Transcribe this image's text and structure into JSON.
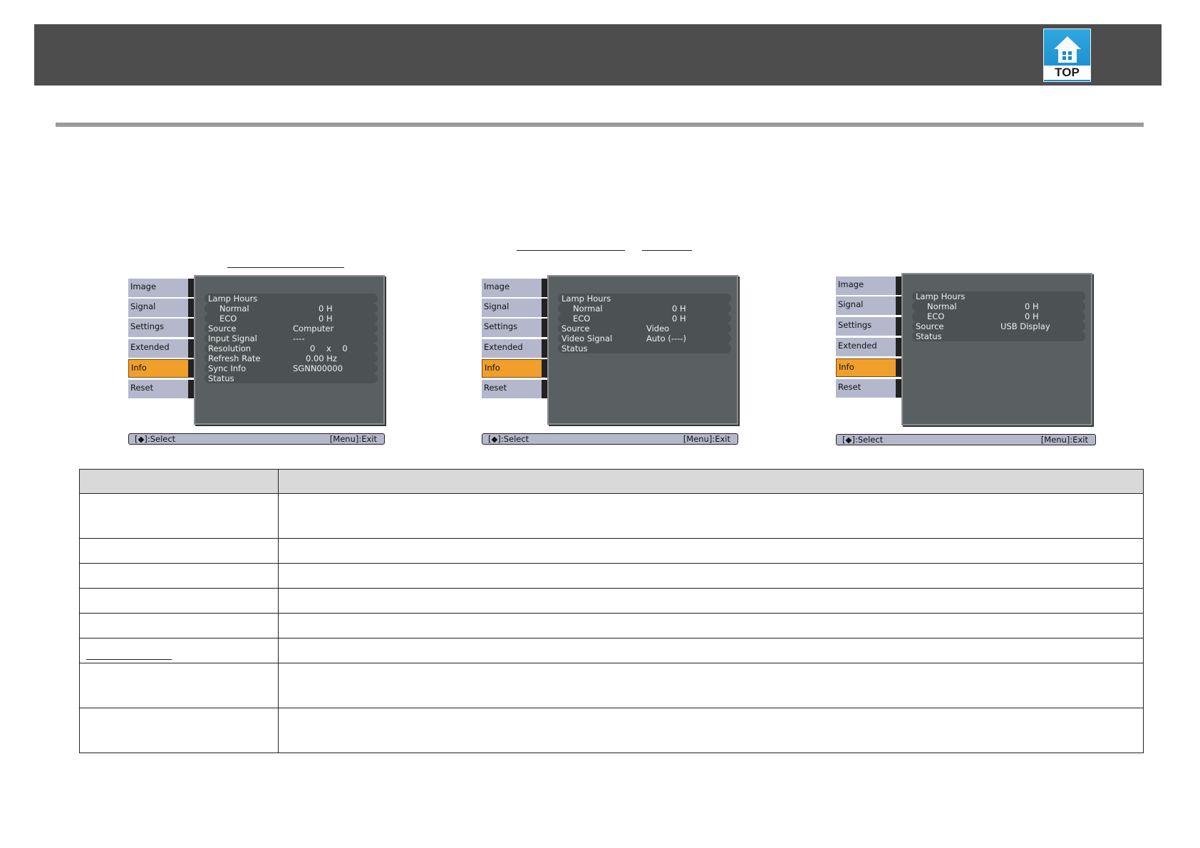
{
  "header": {
    "top_icon_label": "TOP"
  },
  "menus": [
    {
      "tabs": [
        "Image",
        "Signal",
        "Settings",
        "Extended",
        "Info",
        "Reset"
      ],
      "active_tab": "Info",
      "rows": [
        {
          "key": "Lamp Hours",
          "value": "",
          "indent": false
        },
        {
          "key": "Normal",
          "value": "0 H",
          "indent": true
        },
        {
          "key": "ECO",
          "value": "0 H",
          "indent": true
        },
        {
          "key": "Source",
          "value": "Computer",
          "indent": false
        },
        {
          "key": "Input Signal",
          "value": "----",
          "indent": false
        },
        {
          "key": "Resolution",
          "value": "0 x 0",
          "indent": false
        },
        {
          "key": "Refresh Rate",
          "value": "0.00 Hz",
          "indent": false
        },
        {
          "key": "Sync Info",
          "value": "SGNN00000",
          "indent": false
        },
        {
          "key": "Status",
          "value": "",
          "indent": false
        }
      ],
      "select_hint": "[◆]:Select",
      "exit_hint": "[Menu]:Exit"
    },
    {
      "tabs": [
        "Image",
        "Signal",
        "Settings",
        "Extended",
        "Info",
        "Reset"
      ],
      "active_tab": "Info",
      "rows": [
        {
          "key": "Lamp Hours",
          "value": "",
          "indent": false
        },
        {
          "key": "Normal",
          "value": "0 H",
          "indent": true
        },
        {
          "key": "ECO",
          "value": "0 H",
          "indent": true
        },
        {
          "key": "Source",
          "value": "Video",
          "indent": false
        },
        {
          "key": "Video Signal",
          "value": "Auto (----)",
          "indent": false
        },
        {
          "key": "Status",
          "value": "",
          "indent": false
        }
      ],
      "select_hint": "[◆]:Select",
      "exit_hint": "[Menu]:Exit"
    },
    {
      "tabs": [
        "Image",
        "Signal",
        "Settings",
        "Extended",
        "Info",
        "Reset"
      ],
      "active_tab": "Info",
      "rows": [
        {
          "key": "Lamp Hours",
          "value": "",
          "indent": false
        },
        {
          "key": "Normal",
          "value": "0 H",
          "indent": true
        },
        {
          "key": "ECO",
          "value": "0 H",
          "indent": true
        },
        {
          "key": "Source",
          "value": "USB Display",
          "indent": false
        },
        {
          "key": "Status",
          "value": "",
          "indent": false
        }
      ],
      "select_hint": "[◆]:Select",
      "exit_hint": "[Menu]:Exit"
    }
  ],
  "colors": {
    "header_bar": "#4d4d4d",
    "active_tab": "#f0a02a",
    "tab": "#b5b8cc",
    "panel": "#5a6061",
    "table_header": "#d9d9d9"
  }
}
